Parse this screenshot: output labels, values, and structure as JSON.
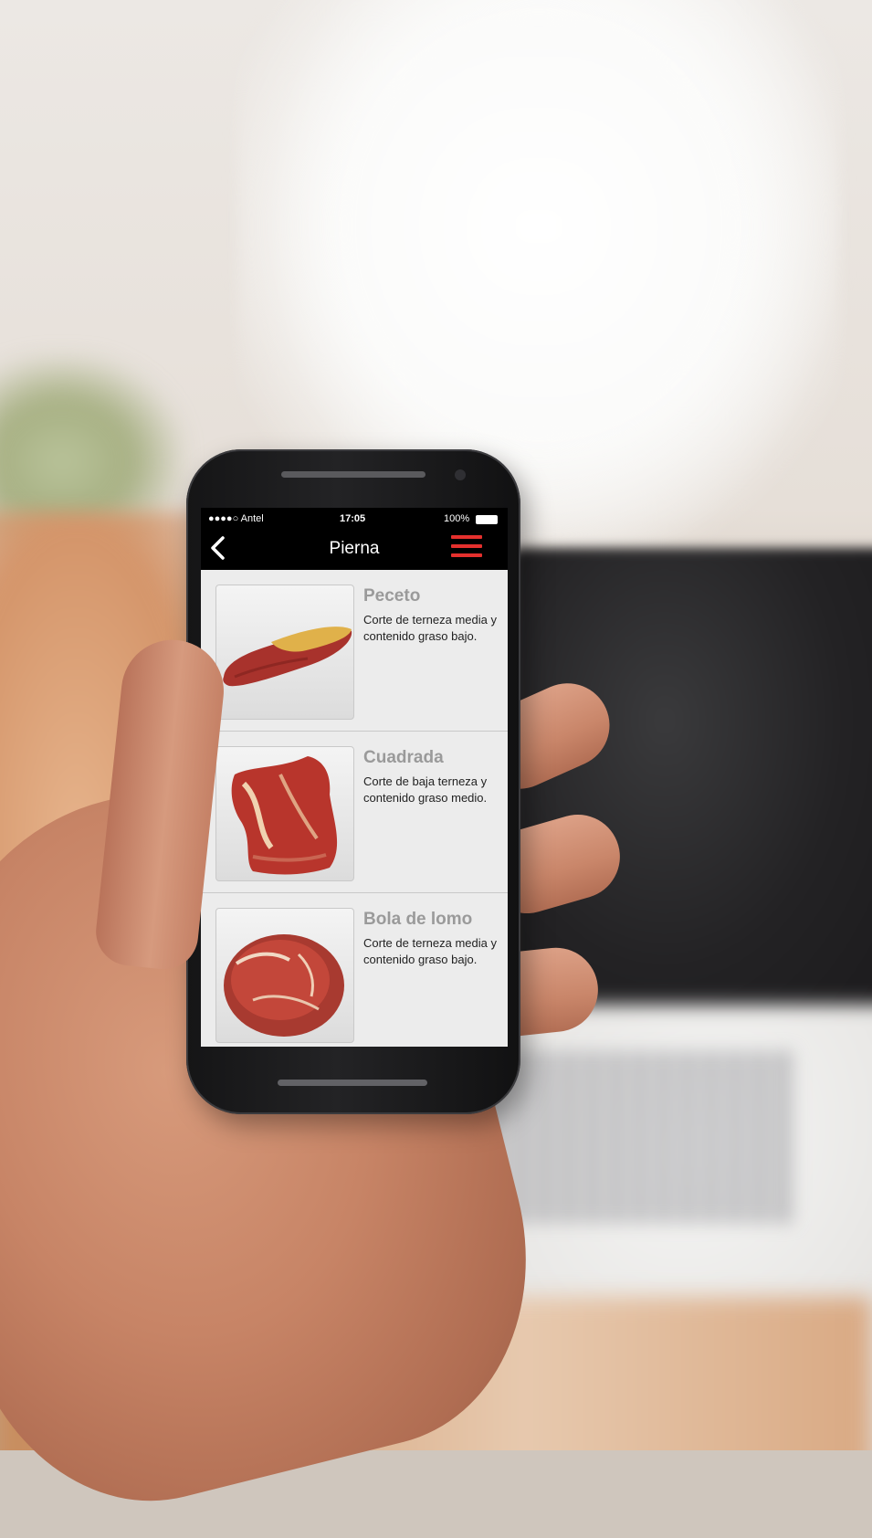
{
  "status_bar": {
    "carrier": "●●●●○ Antel",
    "time": "17:05",
    "battery": "100%"
  },
  "nav": {
    "title": "Pierna"
  },
  "icons": {
    "back": "chevron-left-icon",
    "menu": "hamburger-menu-icon",
    "battery": "battery-icon",
    "wifi": "wifi-icon"
  },
  "colors": {
    "accent": "#e5302d",
    "nav_background": "#000000",
    "list_background": "#ececec",
    "title_gray": "#9a9a9a"
  },
  "cuts": [
    {
      "name": "Peceto",
      "description": "Corte de terneza media y contenido graso bajo."
    },
    {
      "name": "Cuadrada",
      "description": "Corte de baja terneza y contenido graso medio."
    },
    {
      "name": "Bola de lomo",
      "description": "Corte de terneza media y contenido graso bajo."
    }
  ]
}
